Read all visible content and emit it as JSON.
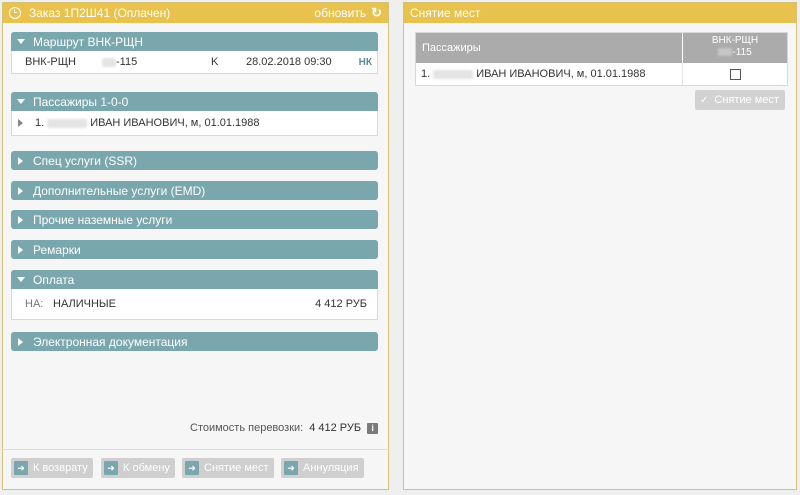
{
  "left_panel": {
    "title": "Заказ 1П2Ш41 (Оплачен)",
    "refresh_label": "обновить",
    "refresh_icon": "refresh-icon",
    "route_section": {
      "title": "Маршрут ВНК-РЩН",
      "segment": {
        "route": "ВНК-РЩН",
        "flight_suffix": "-115",
        "class": "K",
        "datetime": "28.02.2018 09:30",
        "status": "НК"
      }
    },
    "passengers_section": {
      "title": "Пассажиры 1-0-0",
      "passenger_prefix": "1.",
      "passenger_rest": "ИВАН ИВАНОВИЧ, м, 01.01.1988"
    },
    "collapsed_sections": [
      "Спец услуги (SSR)",
      "Дополнительные услуги (EMD)",
      "Прочие наземные услуги",
      "Ремарки"
    ],
    "payment_section": {
      "title": "Оплата",
      "label": "НА:",
      "method": "НАЛИЧНЫЕ",
      "amount": "4 412 РУБ"
    },
    "docs_section": {
      "title": "Электронная документация"
    },
    "cost": {
      "label": "Стоимость перевозки:",
      "value": "4 412 РУБ",
      "info_icon": "i"
    },
    "actions": [
      "К возврату",
      "К обмену",
      "Снятие мест",
      "Аннуляция"
    ]
  },
  "right_panel": {
    "title": "Снятие мест",
    "table": {
      "col_passengers": "Пассажиры",
      "col_segment_route": "ВНК-РЩН",
      "col_segment_flight": "-115",
      "row_prefix": "1.",
      "row_name": "ИВАН ИВАНОВИЧ, м, 01.01.1988",
      "checked": false
    },
    "release_button": "Снятие мест"
  }
}
